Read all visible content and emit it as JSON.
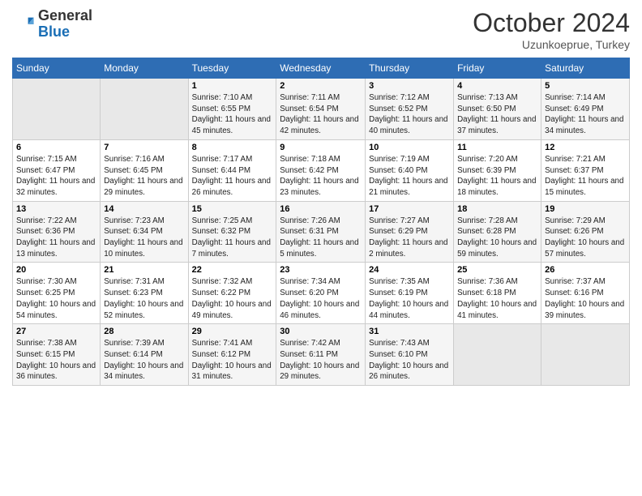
{
  "header": {
    "logo_general": "General",
    "logo_blue": "Blue",
    "month_year": "October 2024",
    "location": "Uzunkoeprue, Turkey"
  },
  "days_of_week": [
    "Sunday",
    "Monday",
    "Tuesday",
    "Wednesday",
    "Thursday",
    "Friday",
    "Saturday"
  ],
  "weeks": [
    [
      {
        "day": "",
        "info": ""
      },
      {
        "day": "",
        "info": ""
      },
      {
        "day": "1",
        "info": "Sunrise: 7:10 AM\nSunset: 6:55 PM\nDaylight: 11 hours and 45 minutes."
      },
      {
        "day": "2",
        "info": "Sunrise: 7:11 AM\nSunset: 6:54 PM\nDaylight: 11 hours and 42 minutes."
      },
      {
        "day": "3",
        "info": "Sunrise: 7:12 AM\nSunset: 6:52 PM\nDaylight: 11 hours and 40 minutes."
      },
      {
        "day": "4",
        "info": "Sunrise: 7:13 AM\nSunset: 6:50 PM\nDaylight: 11 hours and 37 minutes."
      },
      {
        "day": "5",
        "info": "Sunrise: 7:14 AM\nSunset: 6:49 PM\nDaylight: 11 hours and 34 minutes."
      }
    ],
    [
      {
        "day": "6",
        "info": "Sunrise: 7:15 AM\nSunset: 6:47 PM\nDaylight: 11 hours and 32 minutes."
      },
      {
        "day": "7",
        "info": "Sunrise: 7:16 AM\nSunset: 6:45 PM\nDaylight: 11 hours and 29 minutes."
      },
      {
        "day": "8",
        "info": "Sunrise: 7:17 AM\nSunset: 6:44 PM\nDaylight: 11 hours and 26 minutes."
      },
      {
        "day": "9",
        "info": "Sunrise: 7:18 AM\nSunset: 6:42 PM\nDaylight: 11 hours and 23 minutes."
      },
      {
        "day": "10",
        "info": "Sunrise: 7:19 AM\nSunset: 6:40 PM\nDaylight: 11 hours and 21 minutes."
      },
      {
        "day": "11",
        "info": "Sunrise: 7:20 AM\nSunset: 6:39 PM\nDaylight: 11 hours and 18 minutes."
      },
      {
        "day": "12",
        "info": "Sunrise: 7:21 AM\nSunset: 6:37 PM\nDaylight: 11 hours and 15 minutes."
      }
    ],
    [
      {
        "day": "13",
        "info": "Sunrise: 7:22 AM\nSunset: 6:36 PM\nDaylight: 11 hours and 13 minutes."
      },
      {
        "day": "14",
        "info": "Sunrise: 7:23 AM\nSunset: 6:34 PM\nDaylight: 11 hours and 10 minutes."
      },
      {
        "day": "15",
        "info": "Sunrise: 7:25 AM\nSunset: 6:32 PM\nDaylight: 11 hours and 7 minutes."
      },
      {
        "day": "16",
        "info": "Sunrise: 7:26 AM\nSunset: 6:31 PM\nDaylight: 11 hours and 5 minutes."
      },
      {
        "day": "17",
        "info": "Sunrise: 7:27 AM\nSunset: 6:29 PM\nDaylight: 11 hours and 2 minutes."
      },
      {
        "day": "18",
        "info": "Sunrise: 7:28 AM\nSunset: 6:28 PM\nDaylight: 10 hours and 59 minutes."
      },
      {
        "day": "19",
        "info": "Sunrise: 7:29 AM\nSunset: 6:26 PM\nDaylight: 10 hours and 57 minutes."
      }
    ],
    [
      {
        "day": "20",
        "info": "Sunrise: 7:30 AM\nSunset: 6:25 PM\nDaylight: 10 hours and 54 minutes."
      },
      {
        "day": "21",
        "info": "Sunrise: 7:31 AM\nSunset: 6:23 PM\nDaylight: 10 hours and 52 minutes."
      },
      {
        "day": "22",
        "info": "Sunrise: 7:32 AM\nSunset: 6:22 PM\nDaylight: 10 hours and 49 minutes."
      },
      {
        "day": "23",
        "info": "Sunrise: 7:34 AM\nSunset: 6:20 PM\nDaylight: 10 hours and 46 minutes."
      },
      {
        "day": "24",
        "info": "Sunrise: 7:35 AM\nSunset: 6:19 PM\nDaylight: 10 hours and 44 minutes."
      },
      {
        "day": "25",
        "info": "Sunrise: 7:36 AM\nSunset: 6:18 PM\nDaylight: 10 hours and 41 minutes."
      },
      {
        "day": "26",
        "info": "Sunrise: 7:37 AM\nSunset: 6:16 PM\nDaylight: 10 hours and 39 minutes."
      }
    ],
    [
      {
        "day": "27",
        "info": "Sunrise: 7:38 AM\nSunset: 6:15 PM\nDaylight: 10 hours and 36 minutes."
      },
      {
        "day": "28",
        "info": "Sunrise: 7:39 AM\nSunset: 6:14 PM\nDaylight: 10 hours and 34 minutes."
      },
      {
        "day": "29",
        "info": "Sunrise: 7:41 AM\nSunset: 6:12 PM\nDaylight: 10 hours and 31 minutes."
      },
      {
        "day": "30",
        "info": "Sunrise: 7:42 AM\nSunset: 6:11 PM\nDaylight: 10 hours and 29 minutes."
      },
      {
        "day": "31",
        "info": "Sunrise: 7:43 AM\nSunset: 6:10 PM\nDaylight: 10 hours and 26 minutes."
      },
      {
        "day": "",
        "info": ""
      },
      {
        "day": "",
        "info": ""
      }
    ]
  ]
}
